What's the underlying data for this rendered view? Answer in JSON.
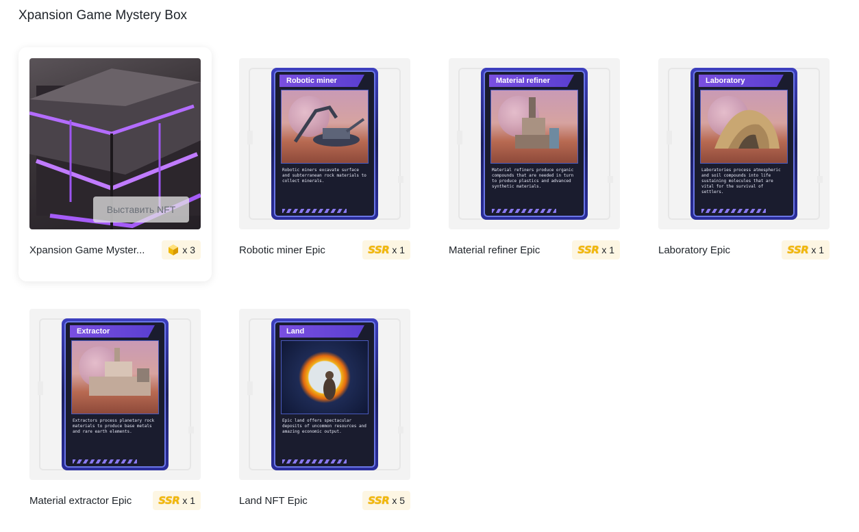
{
  "page": {
    "title": "Xpansion Game Mystery Box"
  },
  "items": [
    {
      "name": "Xpansion Game Myster...",
      "qty": "x 3",
      "badge_type": "cube",
      "action_label": "Выставить NFT"
    },
    {
      "name": "Robotic miner Epic",
      "qty": "x 1",
      "badge_type": "ssr",
      "badge_text": "SSR",
      "card_title": "Robotic miner",
      "card_desc": "Robotic miners excavate surface and subterranean rock materials to collect minerals."
    },
    {
      "name": "Material refiner Epic",
      "qty": "x 1",
      "badge_type": "ssr",
      "badge_text": "SSR",
      "card_title": "Material refiner",
      "card_desc": "Material refiners produce organic compounds that are needed in turn to produce plastics and advanced synthetic materials."
    },
    {
      "name": "Laboratory Epic",
      "qty": "x 1",
      "badge_type": "ssr",
      "badge_text": "SSR",
      "card_title": "Laboratory",
      "card_desc": "Laboratories process atmospheric and soil compounds into life sustaining molecules that are vital for the survival of settlers."
    },
    {
      "name": "Material extractor Epic",
      "qty": "x 1",
      "badge_type": "ssr",
      "badge_text": "SSR",
      "card_title": "Extractor",
      "card_desc": "Extractors process planetary rock materials to produce base metals and rare earth elements."
    },
    {
      "name": "Land NFT Epic",
      "qty": "x 5",
      "badge_type": "ssr",
      "badge_text": "SSR",
      "card_title": "Land",
      "card_desc": "Epic land offers spectacular deposits of uncommon resources and amazing economic output."
    }
  ],
  "colors": {
    "accent": "#f0b90b",
    "badge_bg": "#fdf6e3",
    "thumb_bg": "#f3f3f3"
  },
  "icons": {
    "cube": "cube-icon"
  }
}
